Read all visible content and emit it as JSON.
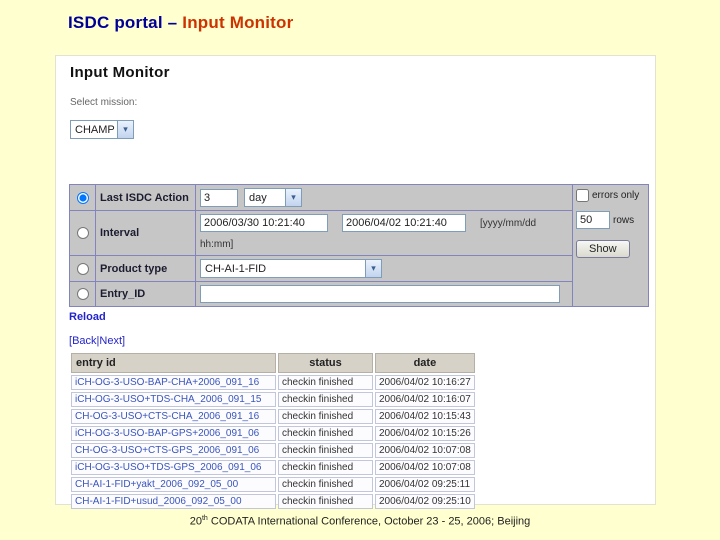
{
  "slide": {
    "title_part1": "ISDC portal – ",
    "title_part2": "Input Monitor",
    "footer": {
      "prefix": "20",
      "sup": "th",
      "rest": " CODATA International Conference, October 23 - 25, 2006; Beijing"
    }
  },
  "icons": {
    "dropdown_arrow": "▾"
  },
  "colors": {
    "slide_background": "#ffffcf",
    "title_blue": "#000099",
    "title_red": "#cc3300",
    "form_background": "#c6c6c6",
    "form_border": "#8383bd",
    "link_blue": "#2323cc",
    "entry_id_blue": "#3a55bb"
  },
  "portal": {
    "heading": "Input Monitor",
    "mission": {
      "label": "Select mission:",
      "selected": "CHAMP"
    },
    "filter_form": {
      "last_action": {
        "label": "Last ISDC Action",
        "value": "3",
        "unit_selected": "day"
      },
      "interval": {
        "label": "Interval",
        "from": "2006/03/30 10:21:40",
        "to": "2006/04/02 10:21:40",
        "format_hint_line1": "[yyyy/mm/dd",
        "format_hint_line2": "hh:mm]"
      },
      "product_type": {
        "label": "Product type",
        "selected": "CH-AI-1-FID"
      },
      "entry_id": {
        "label": "Entry_ID",
        "value": ""
      },
      "errors_only_label": "errors only",
      "rows_value": "50",
      "rows_label": "rows",
      "show_button": "Show"
    },
    "reload_link": "Reload",
    "pager": {
      "open": "[",
      "back": "Back",
      "sep": "|",
      "next": "Next",
      "close": "]"
    },
    "results": {
      "columns": [
        "entry id",
        "status",
        "date"
      ],
      "rows": [
        {
          "entry_id": "iCH-OG-3-USO-BAP-CHA+2006_091_16",
          "status": "checkin finished",
          "date": "2006/04/02 10:16:27"
        },
        {
          "entry_id": "iCH-OG-3-USO+TDS-CHA_2006_091_15",
          "status": "checkin finished",
          "date": "2006/04/02 10:16:07"
        },
        {
          "entry_id": "CH-OG-3-USO+CTS-CHA_2006_091_16",
          "status": "checkin finished",
          "date": "2006/04/02 10:15:43"
        },
        {
          "entry_id": "iCH-OG-3-USO-BAP-GPS+2006_091_06",
          "status": "checkin finished",
          "date": "2006/04/02 10:15:26"
        },
        {
          "entry_id": "CH-OG-3-USO+CTS-GPS_2006_091_06",
          "status": "checkin finished",
          "date": "2006/04/02 10:07:08"
        },
        {
          "entry_id": "iCH-OG-3-USO+TDS-GPS_2006_091_06",
          "status": "checkin finished",
          "date": "2006/04/02 10:07:08"
        },
        {
          "entry_id": "CH-AI-1-FID+yakt_2006_092_05_00",
          "status": "checkin finished",
          "date": "2006/04/02 09:25:11"
        },
        {
          "entry_id": "CH-AI-1-FID+usud_2006_092_05_00",
          "status": "checkin finished",
          "date": "2006/04/02 09:25:10"
        }
      ]
    }
  }
}
